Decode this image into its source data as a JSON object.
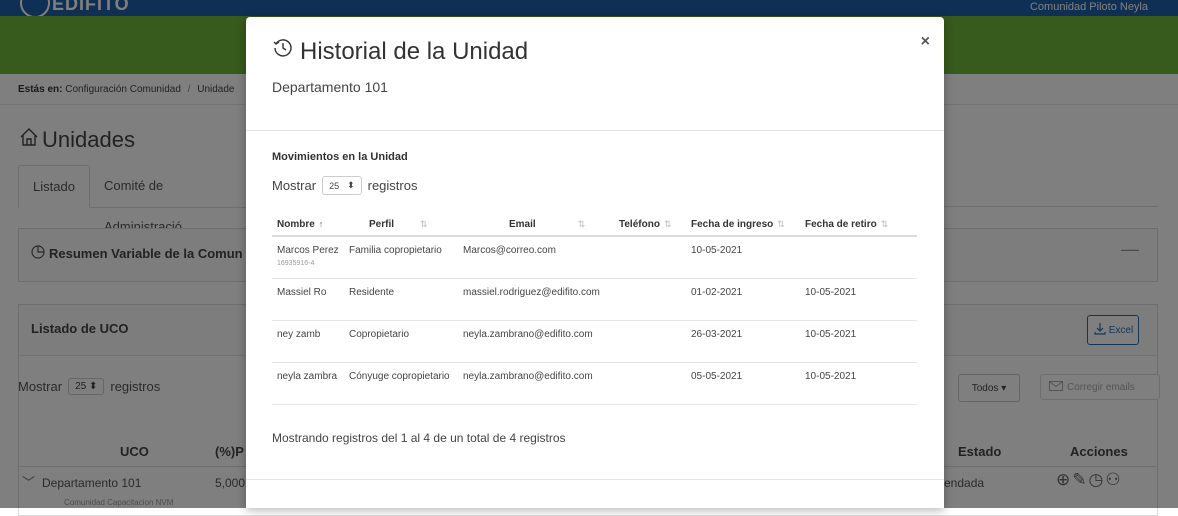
{
  "background": {
    "logo": "EDIFITO",
    "nav_user": "Comunidad Piloto Neyla",
    "breadcrumb": {
      "prefix": "Estás en:",
      "item1": "Configuración Comunidad",
      "separator": "/",
      "item2": "Unidade"
    },
    "page_title": "Unidades",
    "tabs": [
      "Listado",
      "Comité de Administració"
    ],
    "resumen_title": "Resumen Variable de la Comun",
    "uco_card_title": "Listado de UCO",
    "excel_label": "Excel",
    "mostrar": {
      "label": "Mostrar",
      "value": "25",
      "suffix": "registros"
    },
    "todos_label": "Todos",
    "corregir_label": "Corregir emails",
    "table_headers": {
      "uco": "UCO",
      "pct": "(%)P",
      "estado": "Estado",
      "acciones": "Acciones"
    },
    "row": {
      "uco": "Departamento 101",
      "sub": "Comunidad Capacitacion NVM",
      "pct": "5,000",
      "estado": "rendada"
    }
  },
  "modal": {
    "title": "Historial de la Unidad",
    "subtitle": "Departamento 101",
    "close_label": "×",
    "section_title": "Movimientos en la Unidad",
    "mostrar": {
      "label": "Mostrar",
      "value": "25",
      "suffix": "registros"
    },
    "columns": [
      "Nombre",
      "Perfil",
      "Email",
      "Teléfono",
      "Fecha de ingreso",
      "Fecha de retiro"
    ],
    "rows": [
      {
        "nombre": "Marcos Perez",
        "rut": "16935916-4",
        "perfil": "Familia copropietario",
        "email": "Marcos@correo.com",
        "telefono": "",
        "ingreso": "10-05-2021",
        "retiro": ""
      },
      {
        "nombre": "Massiel Ro",
        "rut": "",
        "perfil": "Residente",
        "email": "massiel.rodriguez@edifito.com",
        "telefono": "",
        "ingreso": "01-02-2021",
        "retiro": "10-05-2021"
      },
      {
        "nombre": "ney zamb",
        "rut": "",
        "perfil": "Copropietario",
        "email": "neyla.zambrano@edifito.com",
        "telefono": "",
        "ingreso": "26-03-2021",
        "retiro": "10-05-2021"
      },
      {
        "nombre": "neyla zambra",
        "rut": "",
        "perfil": "Cónyuge copropietario",
        "email": "neyla.zambrano@edifito.com",
        "telefono": "",
        "ingreso": "05-05-2021",
        "retiro": "10-05-2021"
      }
    ],
    "footer_text": "Mostrando registros del 1 al 4 de un total de 4 registros"
  },
  "colors": {
    "nav_blue": "#1e5fa8",
    "green_bar": "#6fb53a",
    "accent_blue": "#2a6db5",
    "overlay": "rgba(0,0,0,0.5)"
  },
  "icons": [
    "clock-history-icon",
    "home-icon",
    "pie-chart-icon",
    "download-icon",
    "envelope-icon",
    "chevron-down-icon",
    "plus-circle-icon",
    "pencil-icon",
    "history-icon",
    "people-icon",
    "sort-icon",
    "close-icon"
  ]
}
